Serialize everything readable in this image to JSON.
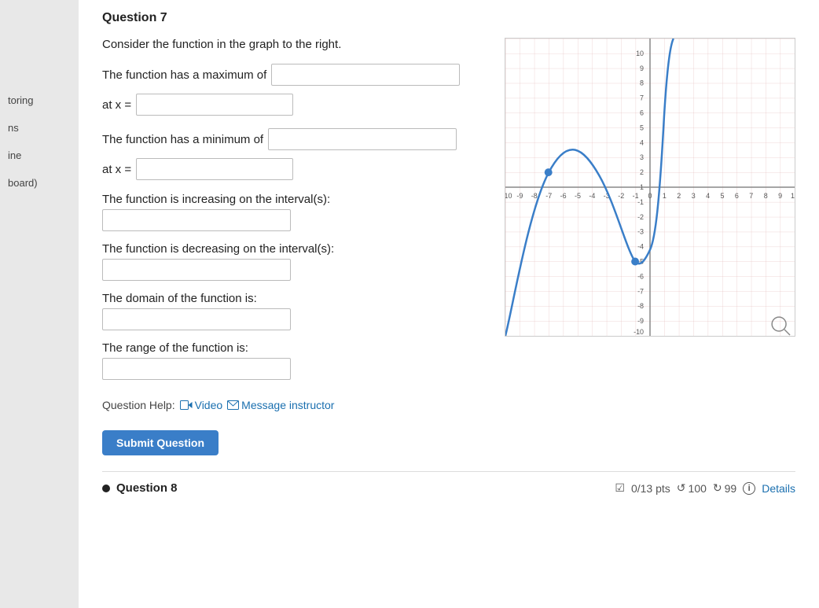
{
  "header": {
    "title": "Question 7"
  },
  "sidebar": {
    "items": [
      {
        "label": "toring"
      },
      {
        "label": "ns"
      },
      {
        "label": "ine"
      },
      {
        "label": "board)"
      }
    ]
  },
  "question": {
    "intro": "Consider the function in the graph to the right.",
    "max_label": "The function has a maximum of",
    "max_at_label": "at x =",
    "min_label": "The function has a minimum of",
    "min_at_label": "at x =",
    "increasing_label": "The function is increasing on the interval(s):",
    "decreasing_label": "The function is decreasing on the interval(s):",
    "domain_label": "The domain of the function is:",
    "range_label": "The range of the function is:",
    "max_value": "",
    "max_x_value": "",
    "min_value": "",
    "min_x_value": "",
    "increasing_value": "",
    "decreasing_value": "",
    "domain_value": "",
    "range_value": ""
  },
  "help": {
    "label": "Question Help:",
    "video_label": "Video",
    "message_label": "Message instructor"
  },
  "submit_btn": "Submit Question",
  "footer": {
    "question_label": "Question 8",
    "score_label": "0/13 pts",
    "undo_label": "100",
    "redo_label": "99",
    "details_label": "Details"
  },
  "graph": {
    "x_min": -10,
    "x_max": 10,
    "y_min": -10,
    "y_max": 10,
    "grid_color": "#e0b0b0",
    "axis_color": "#888",
    "curve_color": "#3a7ec8"
  }
}
